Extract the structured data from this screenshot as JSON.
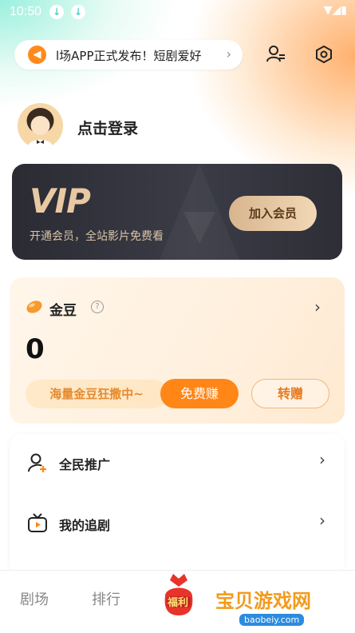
{
  "status_bar": {
    "time": "10:50"
  },
  "notice": {
    "text": "l场APP正式发布！短剧爱好"
  },
  "profile": {
    "login_label": "点击登录"
  },
  "vip_card": {
    "logo": "VIP",
    "subtitle": "开通会员，全站影片免费看",
    "join_label": "加入会员"
  },
  "golden_bean": {
    "title": "金豆",
    "help": "?",
    "count": "0",
    "promo": "海量金豆狂撒中~",
    "earn_label": "免费赚",
    "gift_label": "转赠"
  },
  "menu": [
    {
      "label": "全民推广"
    },
    {
      "label": "我的追剧"
    }
  ],
  "tabbar": {
    "tabs": [
      "剧场",
      "排行"
    ],
    "center": "福利"
  },
  "watermark": {
    "text": "宝贝游戏网",
    "url": "baobeiy.com"
  },
  "colors": {
    "accent": "#ff8617",
    "vip_gold": "#e8c9a3",
    "vip_bg": "#2a2b33"
  }
}
